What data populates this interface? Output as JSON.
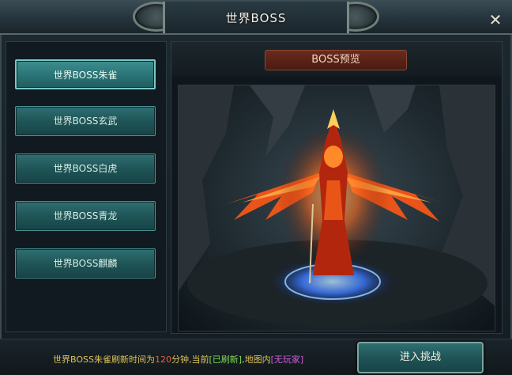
{
  "window": {
    "title": "世界BOSS",
    "close_symbol": "✕"
  },
  "menu": {
    "items": [
      {
        "label": "世界BOSS朱雀",
        "active": true
      },
      {
        "label": "世界BOSS玄武",
        "active": false
      },
      {
        "label": "世界BOSS白虎",
        "active": false
      },
      {
        "label": "世界BOSS青龙",
        "active": false
      },
      {
        "label": "世界BOSS麒麟",
        "active": false
      }
    ]
  },
  "preview": {
    "header": "BOSS预览",
    "boss_image": "fire-phoenix-boss"
  },
  "status": {
    "prefix": "世界BOSS朱雀刷新时间为",
    "minutes": "120",
    "mid": "分钟,当前",
    "state": "[已刷新]",
    "mid2": ",地图内",
    "players": "[无玩家]"
  },
  "actions": {
    "enter_label": "进入挑战"
  },
  "colors": {
    "accent_teal": "#2b7577",
    "status_yellow": "#e0c25a",
    "status_red": "#e26245",
    "status_green": "#7fd65a",
    "status_magenta": "#d05ad9"
  }
}
